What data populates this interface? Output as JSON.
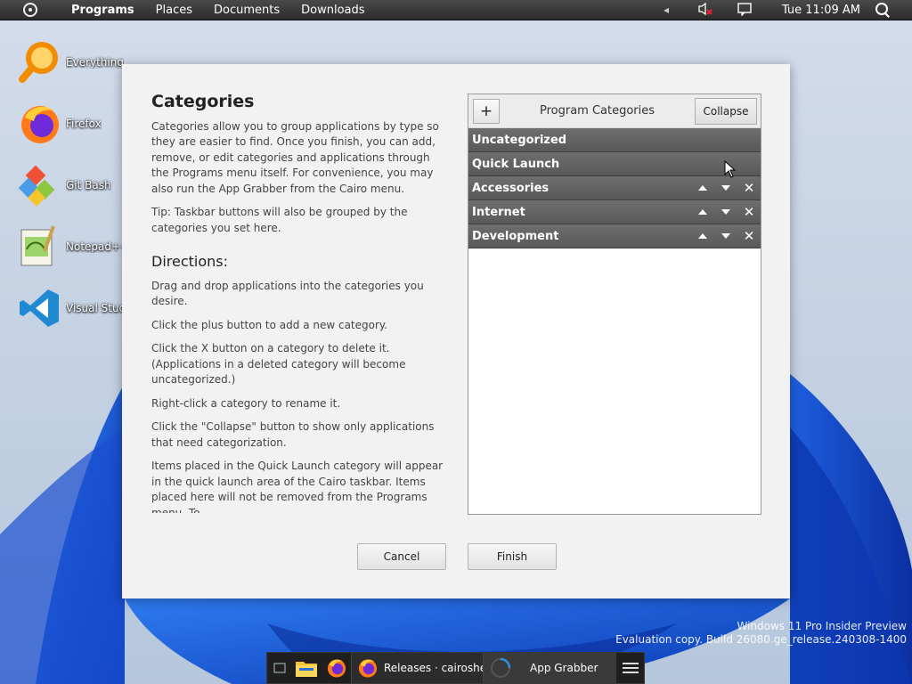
{
  "menubar": {
    "items": [
      "Programs",
      "Places",
      "Documents",
      "Downloads"
    ],
    "clock": "Tue 11:09 AM",
    "tray_arrow": "◂"
  },
  "desktop": {
    "icons": [
      {
        "label": "Everything",
        "icon": "magnifier-icon"
      },
      {
        "label": "Firefox",
        "icon": "firefox-icon"
      },
      {
        "label": "Git Bash",
        "icon": "git-icon"
      },
      {
        "label": "Notepad++",
        "icon": "notepadpp-icon"
      },
      {
        "label": "Visual Studio",
        "icon": "vscode-icon"
      }
    ]
  },
  "dialog": {
    "title": "Categories",
    "intro": "Categories allow you to group applications by type so they are easier to find. Once you finish, you can add, remove, or edit categories and applications through the Programs menu itself. For convenience, you may also run the App Grabber from the Cairo menu.",
    "tip": "Tip: Taskbar buttons will also be grouped by the categories you set here.",
    "directions_heading": "Directions:",
    "directions": [
      "Drag and drop applications into the categories you desire.",
      "Click the plus button to add a new category.",
      "Click the X button on a category to delete it. (Applications in a deleted category will become uncategorized.)",
      "Right-click a category to rename it.",
      "Click the \"Collapse\" button to show only applications that need categorization.",
      "Items placed in the Quick Launch category will appear in the quick launch area of the Cairo taskbar. Items placed here will not be removed from the Programs menu.  To"
    ],
    "panel": {
      "plus_label": "+",
      "title": "Program Categories",
      "collapse_label": "Collapse",
      "categories": [
        {
          "name": "Uncategorized",
          "controls": false
        },
        {
          "name": "Quick Launch",
          "controls": false
        },
        {
          "name": "Accessories",
          "controls": true
        },
        {
          "name": "Internet",
          "controls": true
        },
        {
          "name": "Development",
          "controls": true
        }
      ],
      "delete_glyph": "✕"
    },
    "cancel_label": "Cancel",
    "finish_label": "Finish"
  },
  "watermark": {
    "line1": "Windows 11 Pro Insider Preview",
    "line2": "Evaluation copy. Build 26080.ge_release.240308-1400"
  },
  "taskbar": {
    "buttons": [
      {
        "label": "Releases · cairoshe...",
        "icon": "firefox-icon"
      },
      {
        "label": "App Grabber",
        "icon": "app-grabber-icon"
      }
    ]
  }
}
